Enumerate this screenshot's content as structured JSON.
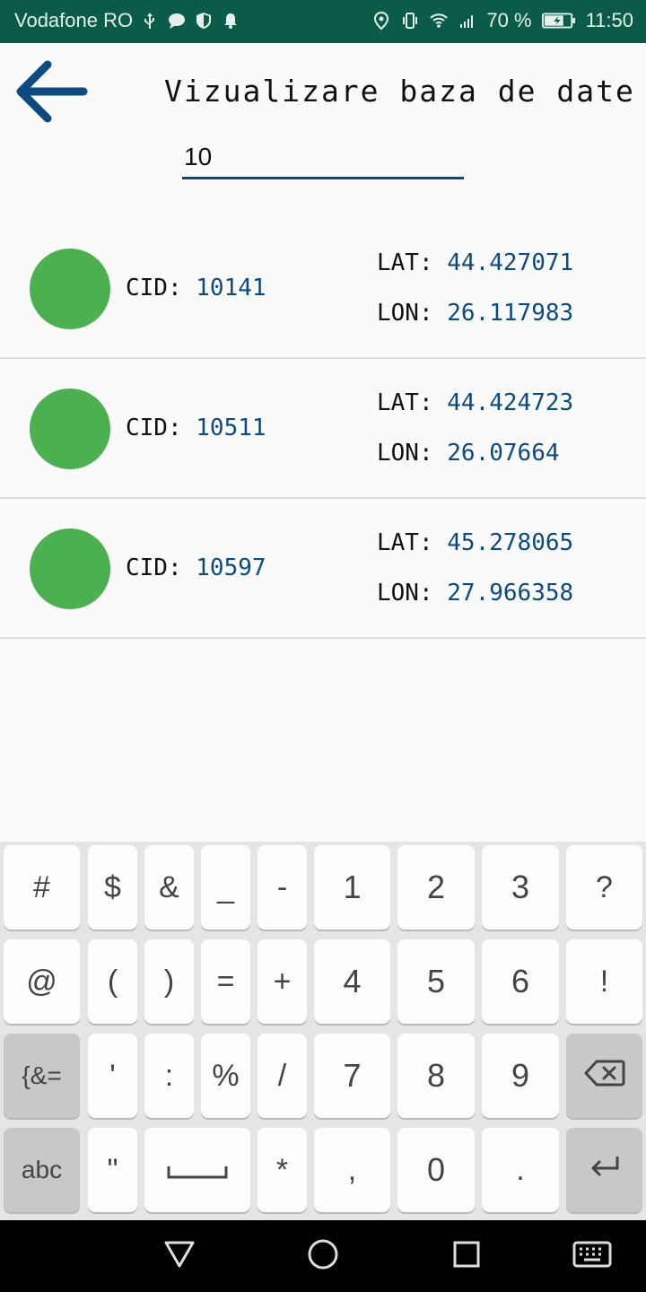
{
  "status_bar": {
    "carrier": "Vodafone RO",
    "battery_percent": "70 %",
    "time": "11:50",
    "left_icons": [
      "usb-icon",
      "message-icon",
      "shield-icon",
      "bell-icon"
    ],
    "right_icons": [
      "location-icon",
      "vibrate-icon",
      "wifi-icon",
      "signal-icon",
      "battery-icon"
    ]
  },
  "header": {
    "title": "Vizualizare baza de date",
    "back_icon": "arrow-left-icon",
    "accent_color": "#0d4a80"
  },
  "search": {
    "value": "10"
  },
  "records": [
    {
      "cid_label": "CID:",
      "cid": "10141",
      "lat_label": "LAT:",
      "lat": "44.427071",
      "lon_label": "LON:",
      "lon": "26.117983"
    },
    {
      "cid_label": "CID:",
      "cid": "10511",
      "lat_label": "LAT:",
      "lat": "44.424723",
      "lon_label": "LON:",
      "lon": "26.07664"
    },
    {
      "cid_label": "CID:",
      "cid": "10597",
      "lat_label": "LAT:",
      "lat": "45.278065",
      "lon_label": "LON:",
      "lon": "27.966358"
    }
  ],
  "status_dot_color": "#4caf50",
  "keyboard": {
    "rows": [
      [
        "#",
        "$",
        "&",
        "_",
        "-",
        "1",
        "2",
        "3",
        "?"
      ],
      [
        "@",
        "(",
        ")",
        "=",
        "+",
        "4",
        "5",
        "6",
        "!"
      ],
      [
        "{&=",
        "'",
        ":",
        "%",
        "/",
        "7",
        "8",
        "9",
        "⌫"
      ],
      [
        "abc",
        "\"",
        "␣",
        "*",
        ",",
        "0",
        ".",
        "↵"
      ]
    ]
  },
  "nav_bar": {
    "icons": [
      "back-triangle-icon",
      "home-circle-icon",
      "recents-square-icon",
      "keyboard-icon"
    ]
  }
}
